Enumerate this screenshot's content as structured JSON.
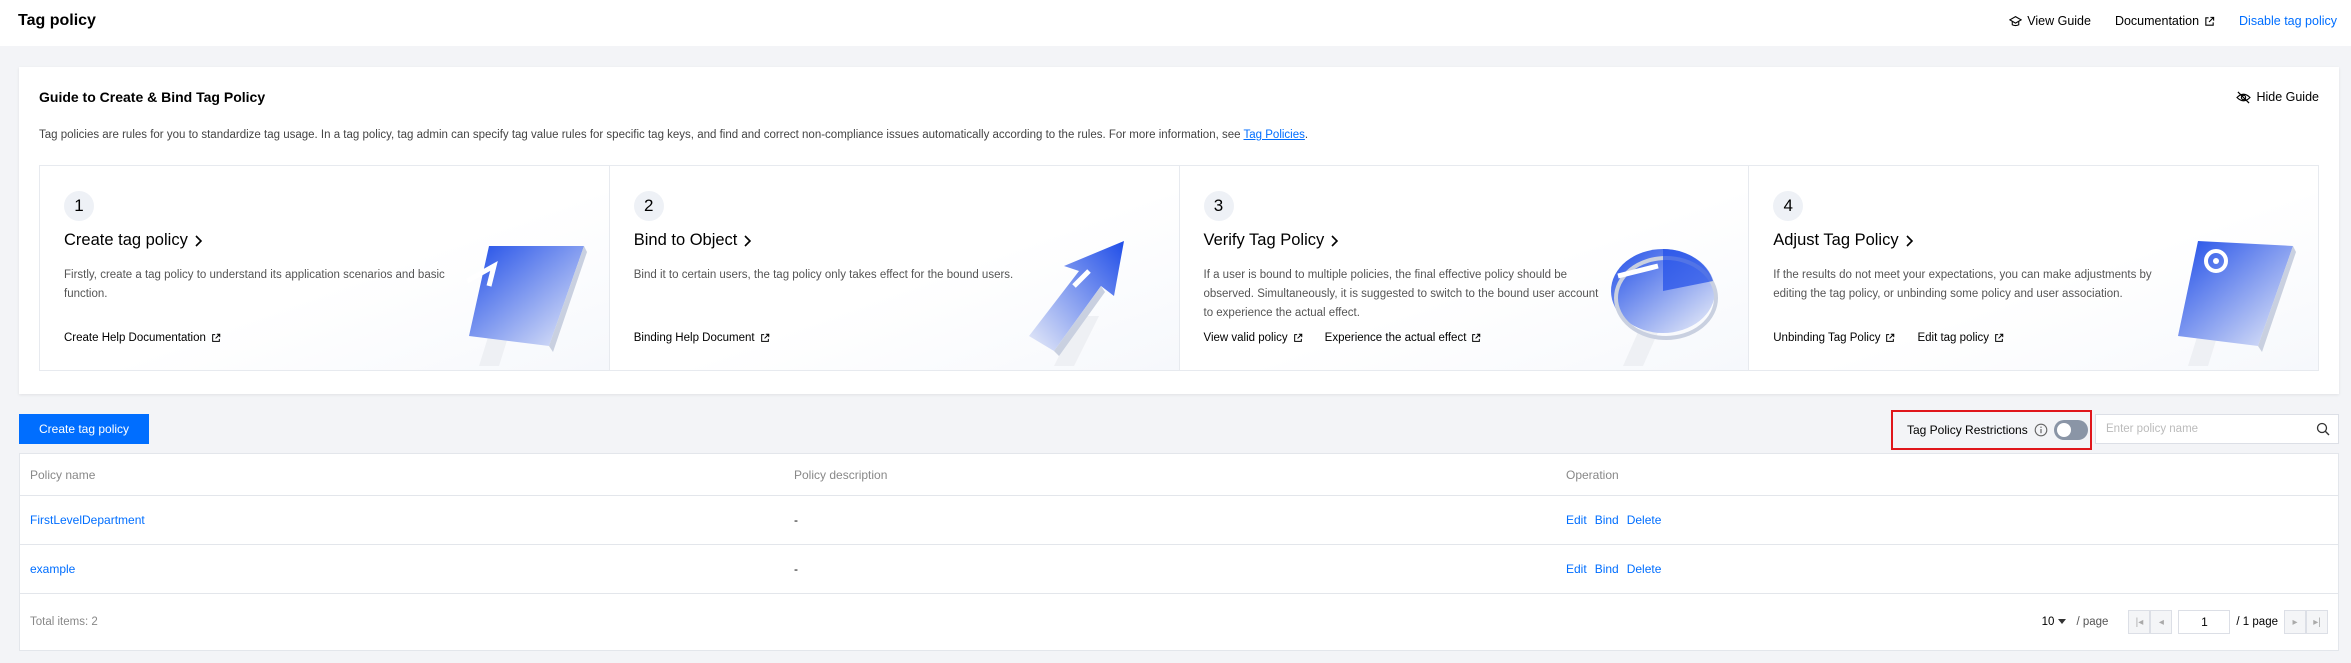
{
  "header": {
    "title": "Tag policy",
    "view_guide": "View Guide",
    "documentation": "Documentation",
    "disable": "Disable tag policy"
  },
  "guide": {
    "title": "Guide to Create & Bind Tag Policy",
    "hide": "Hide Guide",
    "desc_prefix": "Tag policies are rules for you to standardize tag usage. In a tag policy, tag admin can specify tag value rules for specific tag keys, and find and correct non-compliance issues automatically according to the rules. For more information, see ",
    "desc_link": "Tag Policies",
    "desc_suffix": ".",
    "steps": [
      {
        "num": "1",
        "title": "Create tag policy",
        "desc": "Firstly, create a tag policy to understand its application scenarios and basic function.",
        "links": [
          "Create Help Documentation"
        ]
      },
      {
        "num": "2",
        "title": "Bind to Object",
        "desc": "Bind it to certain users, the tag policy only takes effect for the bound users.",
        "links": [
          "Binding Help Document"
        ]
      },
      {
        "num": "3",
        "title": "Verify Tag Policy",
        "desc": "If a user is bound to multiple policies, the final effective policy should be observed. Simultaneously, it is suggested to switch to the bound user account to experience the actual effect.",
        "links": [
          "View valid policy",
          "Experience the actual effect"
        ]
      },
      {
        "num": "4",
        "title": "Adjust Tag Policy",
        "desc": "If the results do not meet your expectations, you can make adjustments by editing the tag policy, or unbinding some policy and user association.",
        "links": [
          "Unbinding Tag Policy",
          "Edit tag policy"
        ]
      }
    ]
  },
  "toolbar": {
    "create": "Create tag policy",
    "restrictions": "Tag Policy Restrictions",
    "restrictions_enabled": false,
    "search_placeholder": "Enter policy name"
  },
  "table": {
    "columns": [
      "Policy name",
      "Policy description",
      "Operation"
    ],
    "rows": [
      {
        "name": "FirstLevelDepartment",
        "desc": "-",
        "ops": [
          "Edit",
          "Bind",
          "Delete"
        ]
      },
      {
        "name": "example",
        "desc": "-",
        "ops": [
          "Edit",
          "Bind",
          "Delete"
        ]
      }
    ],
    "total": "Total items: 2",
    "page_size": "10",
    "per_page": "/ page",
    "page": "1",
    "page_total": "/ 1 page"
  },
  "colors": {
    "accent": "#006eff",
    "highlight": "#e0161b",
    "toggle_off": "#8a95a6"
  }
}
